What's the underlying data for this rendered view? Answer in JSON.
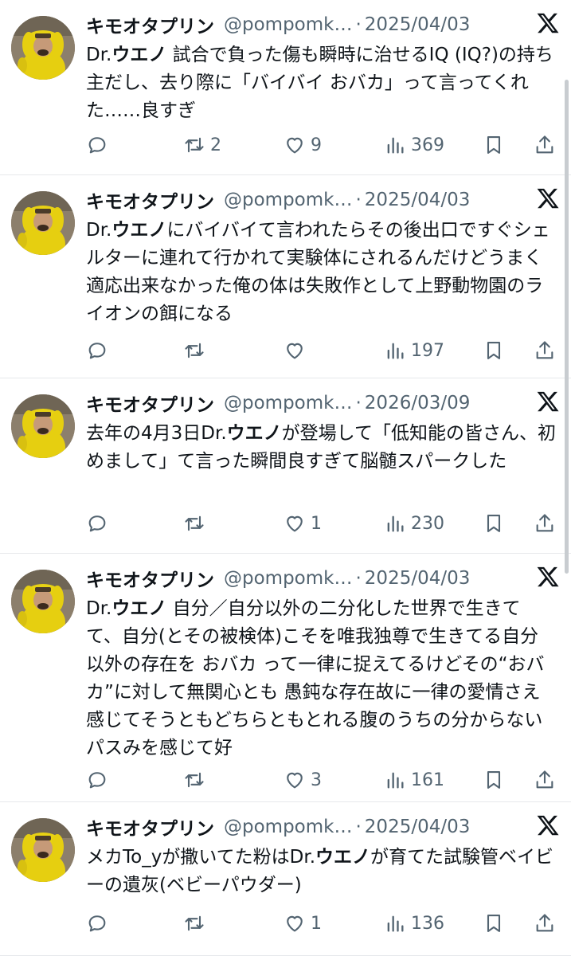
{
  "tweets": [
    {
      "name": "キモオタプリン",
      "handle": "@pompomk…",
      "separator": "·",
      "date": "2025/04/03",
      "text_parts": [
        "Dr.",
        "ウエノ",
        " 試合で負った傷も瞬時に治せるIQ (IQ?)の持ち主だし、去り際に「バイバイ おバカ」って言ってくれた……良すぎ"
      ],
      "retweets": "2",
      "likes": "9",
      "views": "369"
    },
    {
      "name": "キモオタプリン",
      "handle": "@pompomk…",
      "separator": "·",
      "date": "2025/04/03",
      "text_parts": [
        "Dr.",
        "ウエノ",
        "にバイバイて言われたらその後出口ですぐシェルターに連れて行かれて実験体にされるんだけどうまく適応出来なかった俺の体は失敗作として上野動物園のライオンの餌になる"
      ],
      "retweets": "",
      "likes": "",
      "views": "197"
    },
    {
      "name": "キモオタプリン",
      "handle": "@pompomk…",
      "separator": "·",
      "date": "2026/03/09",
      "text_parts": [
        "去年の4月3日Dr.",
        "ウエノ",
        "が登場して「低知能の皆さん、初めまして」て言った瞬間良すぎて脳髄スパークした"
      ],
      "retweets": "",
      "likes": "1",
      "views": "230"
    },
    {
      "name": "キモオタプリン",
      "handle": "@pompomk…",
      "separator": "·",
      "date": "2025/04/03",
      "text_parts": [
        "Dr.",
        "ウエノ",
        " 自分／自分以外の二分化した世界で生きてて、自分(とその被検体)こそを唯我独尊で生きてる自分以外の存在を おバカ って一律に捉えてるけどその“おバカ”に対して無関心とも 愚鈍な存在故に一律の愛情さえ感じてそうともどちらともとれる腹のうちの分からないパスみを感じて好"
      ],
      "retweets": "",
      "likes": "3",
      "views": "161"
    },
    {
      "name": "キモオタプリン",
      "handle": "@pompomk…",
      "separator": "·",
      "date": "2025/04/03",
      "text_parts": [
        "メカTo_yが撒いてた粉はDr.",
        "ウエノ",
        "が育てた試験管ベイビーの遺灰(ベビーパウダー)"
      ],
      "retweets": "",
      "likes": "1",
      "views": "136"
    }
  ],
  "icons": {
    "reply": "reply-icon",
    "retweet": "retweet-icon",
    "like": "heart-icon",
    "views": "views-icon",
    "bookmark": "bookmark-icon",
    "share": "share-icon",
    "x_logo": "x-logo-icon"
  },
  "colors": {
    "text": "#0f1419",
    "muted": "#536471",
    "divider": "#e6e8eb",
    "avatar_yellow": "#e6cf10"
  }
}
